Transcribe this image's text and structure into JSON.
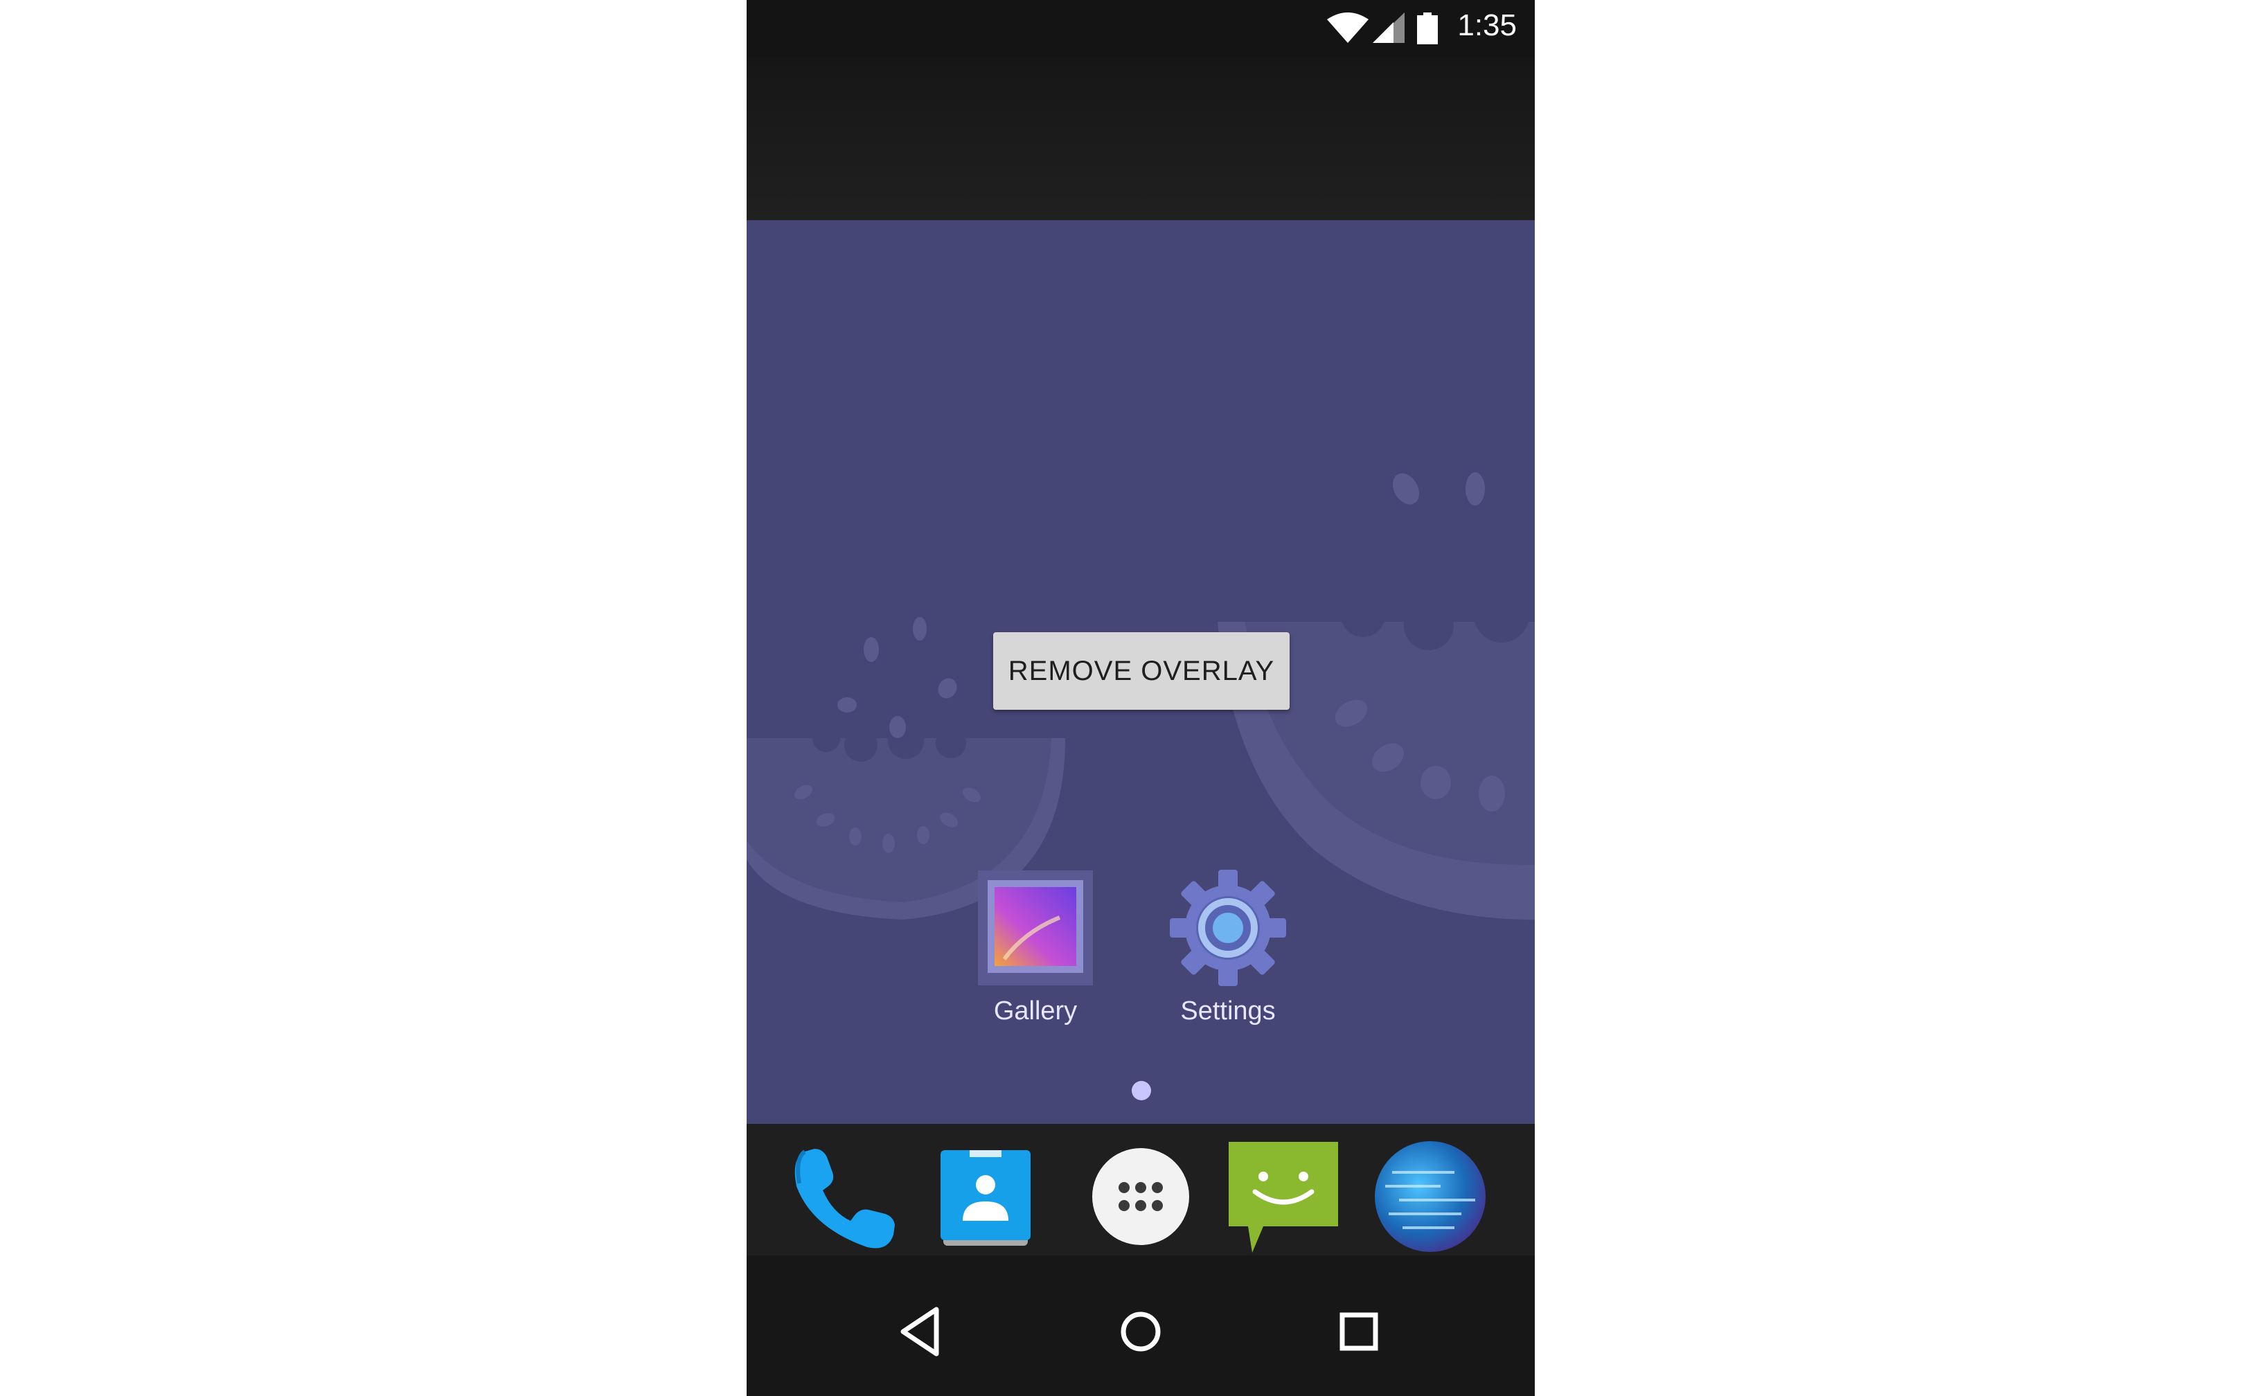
{
  "status_bar": {
    "time": "1:35",
    "icons": [
      "wifi-icon",
      "cellular-signal-icon",
      "battery-icon"
    ]
  },
  "overlay": {
    "button_label": "REMOVE OVERLAY"
  },
  "home_screen": {
    "apps": [
      {
        "label": "Gallery",
        "icon": "gallery-icon"
      },
      {
        "label": "Settings",
        "icon": "settings-gear-icon"
      }
    ],
    "page_count": 1,
    "current_page": 1
  },
  "dock": {
    "items": [
      "phone-icon",
      "contacts-icon",
      "app-drawer-icon",
      "messaging-icon",
      "browser-globe-icon"
    ]
  },
  "nav_bar": {
    "buttons": [
      "back-icon",
      "home-icon",
      "recents-icon"
    ]
  },
  "colors": {
    "wallpaper": "#464676",
    "button_bg": "#d7d7d7",
    "accent_blue": "#1e9fe8",
    "messaging_green": "#8ab82e"
  }
}
